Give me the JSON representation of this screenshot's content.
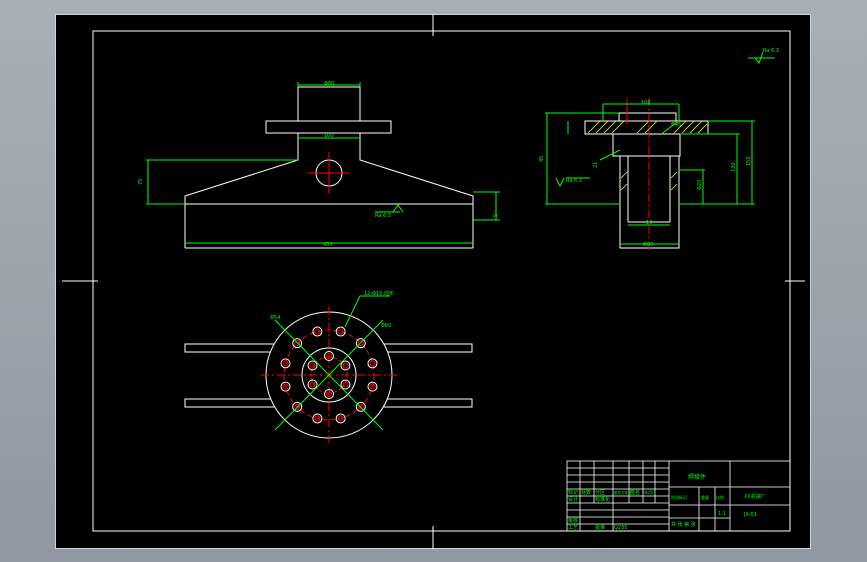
{
  "drawing": {
    "colors": {
      "outline": "#ffffff",
      "dimension": "#00ff00",
      "centerline": "#ff0000",
      "hidden": "#ffff00",
      "background": "#000000",
      "surround": "#9aa3ad"
    },
    "front_view": {
      "dims": {
        "top_width": "Φ80",
        "plate": "100",
        "height": "75",
        "base_width": "400",
        "base_thk": "5"
      },
      "roughness": "Ra 6.3"
    },
    "section_view": {
      "dims": {
        "top": "100",
        "d1": "Φ45",
        "left_h": "45",
        "right_h1": "150",
        "right_h2": "130",
        "hole": "Φ20",
        "bottom": "Φ80",
        "inner": "10",
        "r1": "21"
      },
      "roughness": "Ra 6.3",
      "roughness_corner": "Ra 6.3"
    },
    "plan_view": {
      "callouts": {
        "holes": "12-Φ15 均布",
        "pcd1": "Φ54",
        "pcd2": "Φ80"
      }
    },
    "title_block": {
      "part_name": "焊接件",
      "drawing_no": "JX-01",
      "company": "XX机械厂",
      "scale": "1:1",
      "material": "Q235",
      "sheet_info": "共 张 第 张",
      "rows": {
        "designer": "设计",
        "checker": "审核",
        "process": "工艺",
        "standard": "标准化",
        "approve": "批准",
        "mark": "标记",
        "count": "处数",
        "zone": "分区",
        "change": "更改文件号",
        "sign": "签名",
        "date": "年月日",
        "stage": "阶段标记",
        "weight": "重量",
        "ratio": "比例"
      }
    }
  }
}
